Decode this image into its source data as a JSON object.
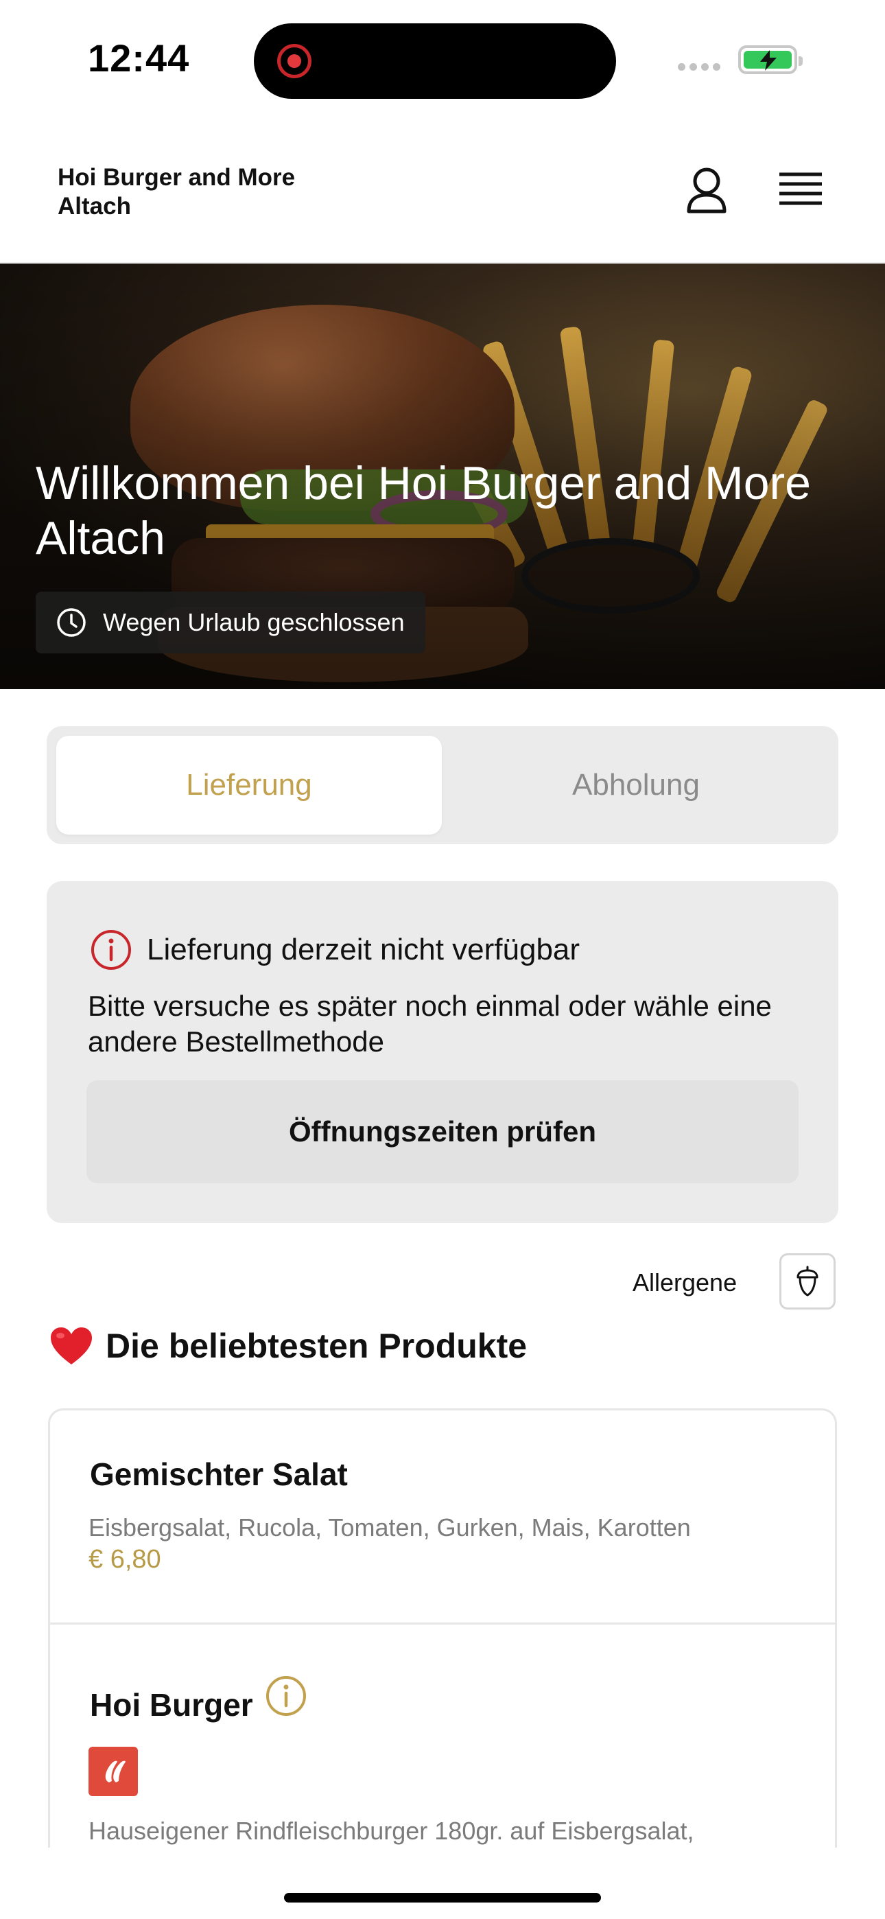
{
  "status_bar": {
    "time": "12:44"
  },
  "header": {
    "restaurant_name": "Hoi Burger and More Altach"
  },
  "hero": {
    "title": "Willkommen bei Hoi Burger and More Altach",
    "status": "Wegen Urlaub geschlossen"
  },
  "order_method": {
    "options": [
      "Lieferung",
      "Abholung"
    ],
    "selected": "Lieferung"
  },
  "notice": {
    "title": "Lieferung derzeit nicht verfügbar",
    "body": "Bitte versuche es später noch einmal oder wähle eine andere Bestellmethode",
    "button_label": "Öffnungszeiten prüfen"
  },
  "allergens": {
    "label": "Allergene"
  },
  "section": {
    "emoji": "❤️",
    "title": "Die beliebtesten Produkte"
  },
  "products": [
    {
      "name": "Gemischter Salat",
      "description": "Eisbergsalat, Rucola, Tomaten, Gurken, Mais, Karotten",
      "price": "€ 6,80"
    },
    {
      "name": "Hoi Burger",
      "description": "Hauseigener Rindfleischburger 180gr. auf Eisbergsalat,",
      "badge_icon": "chili-icon"
    }
  ],
  "colors": {
    "accent_gold": "#c1a14e",
    "alert_red": "#c8262a",
    "spicy_red": "#e04a3a"
  }
}
